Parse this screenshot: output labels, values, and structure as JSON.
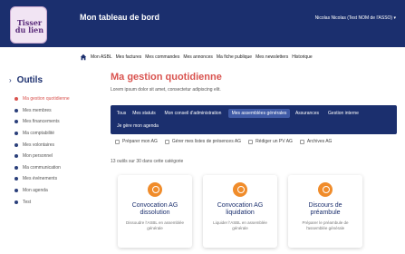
{
  "header": {
    "logo_text": "Tisser du lien",
    "title": "Mon tableau de bord",
    "user": "Nicolas Nicolas (Test NOM de l'ASSO) ▾"
  },
  "topnav": {
    "items": [
      "Mon ASBL",
      "Mes factures",
      "Mes commandes",
      "Mes annonces",
      "Ma fiche publique",
      "Mes newsletters",
      "Historique"
    ]
  },
  "sidebar": {
    "title": "Outils",
    "items": [
      "Ma gestion quotidienne",
      "Mes membres",
      "Mes financements",
      "Ma comptabilité",
      "Mes volontaires",
      "Mon personnel",
      "Ma communication",
      "Mes événements",
      "Mon agenda",
      "Test"
    ],
    "active_index": 0
  },
  "main": {
    "title": "Ma gestion quotidienne",
    "lead": "Lorem ipsum dolor sit amet, consectetur adipiscing elit.",
    "tabs": [
      "Tous",
      "Mes statuts",
      "Mon conseil d'administration",
      "Mes assemblées générales",
      "Assurances",
      "Gestion interne",
      "Je gère mon agenda"
    ],
    "active_tab": "Mes assemblées générales",
    "filters": [
      "Préparer mon AG",
      "Gérer mes listes de présences AG",
      "Rédiger un PV AG",
      "Archives AG"
    ],
    "count_text": "13 outils sur 30 dans cette catégorie",
    "cards": [
      {
        "title_line1": "Convocation AG",
        "title_line2": "dissolution",
        "desc": "Dissoudre l'ASBL en assemblée générale"
      },
      {
        "title_line1": "Convocation AG",
        "title_line2": "liquidation",
        "desc": "Liquider l'ASBL en assemblée générale"
      },
      {
        "title_line1": "Discours de",
        "title_line2": "préambule",
        "desc": "Préparer le préambule de l'assemblée générale"
      }
    ]
  },
  "colors": {
    "navy": "#1b2f6e",
    "accent_red": "#d9534f",
    "orange": "#f08c2b"
  }
}
